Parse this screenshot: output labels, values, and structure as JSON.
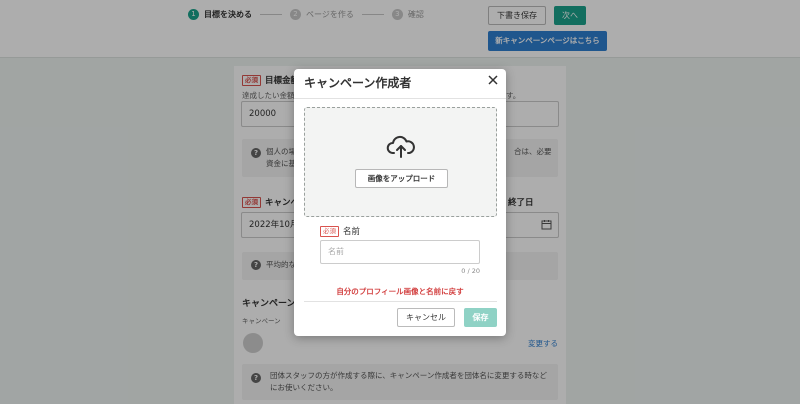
{
  "steps": [
    {
      "number": "1",
      "label": "目標を決める"
    },
    {
      "number": "2",
      "label": "ページを作る"
    },
    {
      "number": "3",
      "label": "確認"
    }
  ],
  "header": {
    "draft_save": "下書き保存",
    "next": "次へ",
    "new_campaign_page": "新キャンペーンページはこちら"
  },
  "form": {
    "required_badge": "必須",
    "goal_label": "目標金額",
    "goal_desc": "達成したい金額",
    "goal_desc_tail": "す。",
    "goal_value": "20000",
    "goal_info_left": "個人の場",
    "goal_info_left2": "資金に基",
    "goal_info_right": "合は、必要",
    "period_label": "キャンペ",
    "period_label_right": "終了日",
    "period_value": "2022年10月",
    "period_info": "平均的な",
    "creator_title": "キャンペーン",
    "creator_desc": "キャンペーン",
    "change": "変更する",
    "group_info": "団体スタッフの方が作成する際に、キャンペーン作成者を団体名に変更する時などにお使いください。"
  },
  "modal": {
    "title": "キャンペーン作成者",
    "upload_button": "画像をアップロード",
    "required_badge": "必須",
    "name_label": "名前",
    "name_placeholder": "名前",
    "char_count": "0 / 20",
    "reset_link": "自分のプロフィール画像と名前に戻す",
    "cancel": "キャンセル",
    "save": "保存"
  },
  "colors": {
    "accent": "#1ba38c",
    "link": "#2f7fd0",
    "required": "#d9534f",
    "reset_link": "#d34242"
  },
  "icons": {
    "close": "close-icon",
    "upload": "cloud-upload-icon",
    "calendar": "calendar-icon",
    "info": "question-circle-icon"
  }
}
